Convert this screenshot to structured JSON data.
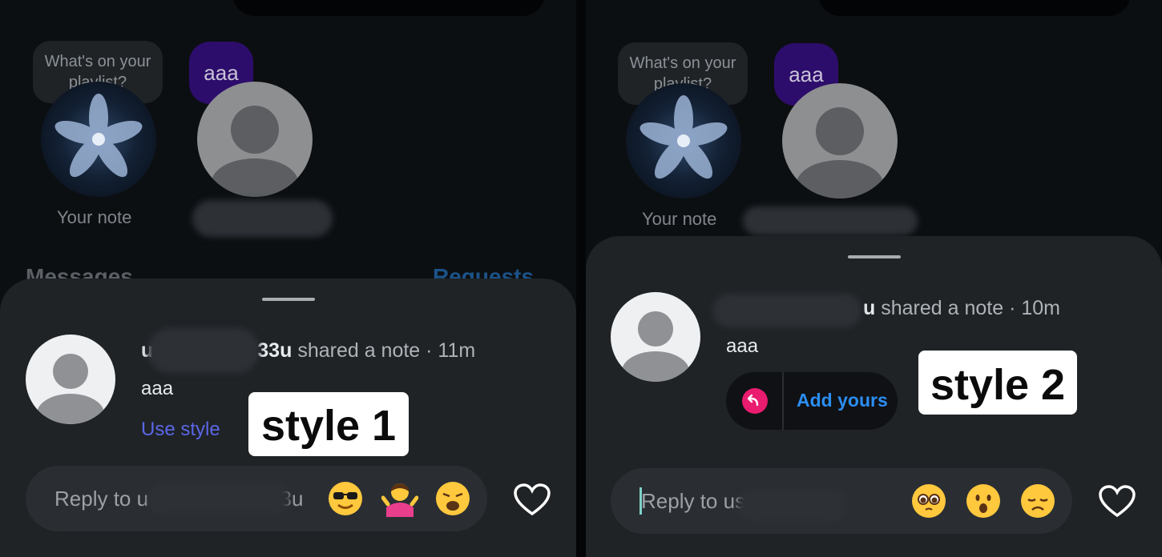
{
  "left": {
    "note_prompt": "What's on your playlist?",
    "friend_note": "aaa",
    "own_caption": "Your note",
    "messages_heading": "Messages",
    "requests_link": "Requests",
    "sheet": {
      "username_start": "u",
      "username_end": "33u",
      "headline_suffix": " shared a note · 11m",
      "note_text": "aaa",
      "use_style": "Use style",
      "reply_placeholder_visible": "Reply to u",
      "reply_placeholder_tail": "33u",
      "emojis": [
        "smiling-face-with-sunglasses",
        "person-shrugging",
        "weary-face"
      ]
    },
    "overlay_label": "style 1"
  },
  "right": {
    "note_prompt": "What's on your playlist?",
    "friend_note": "aaa",
    "own_caption": "Your note",
    "sheet": {
      "username_end": "u",
      "headline_suffix": " shared a note · 10m",
      "note_text": "aaa",
      "add_yours": "Add yours",
      "reply_placeholder_visible": "Reply to us",
      "emojis": [
        "pleading-face",
        "face-with-open-mouth",
        "disappointed-face"
      ]
    },
    "overlay_label": "style 2"
  },
  "colors": {
    "sheet": "#1f2326",
    "accent_blue": "#2c8ef3",
    "use_style": "#5b67e6",
    "note_purple": "#2d0d6b",
    "add_yours_pink": "#ea1c70"
  }
}
